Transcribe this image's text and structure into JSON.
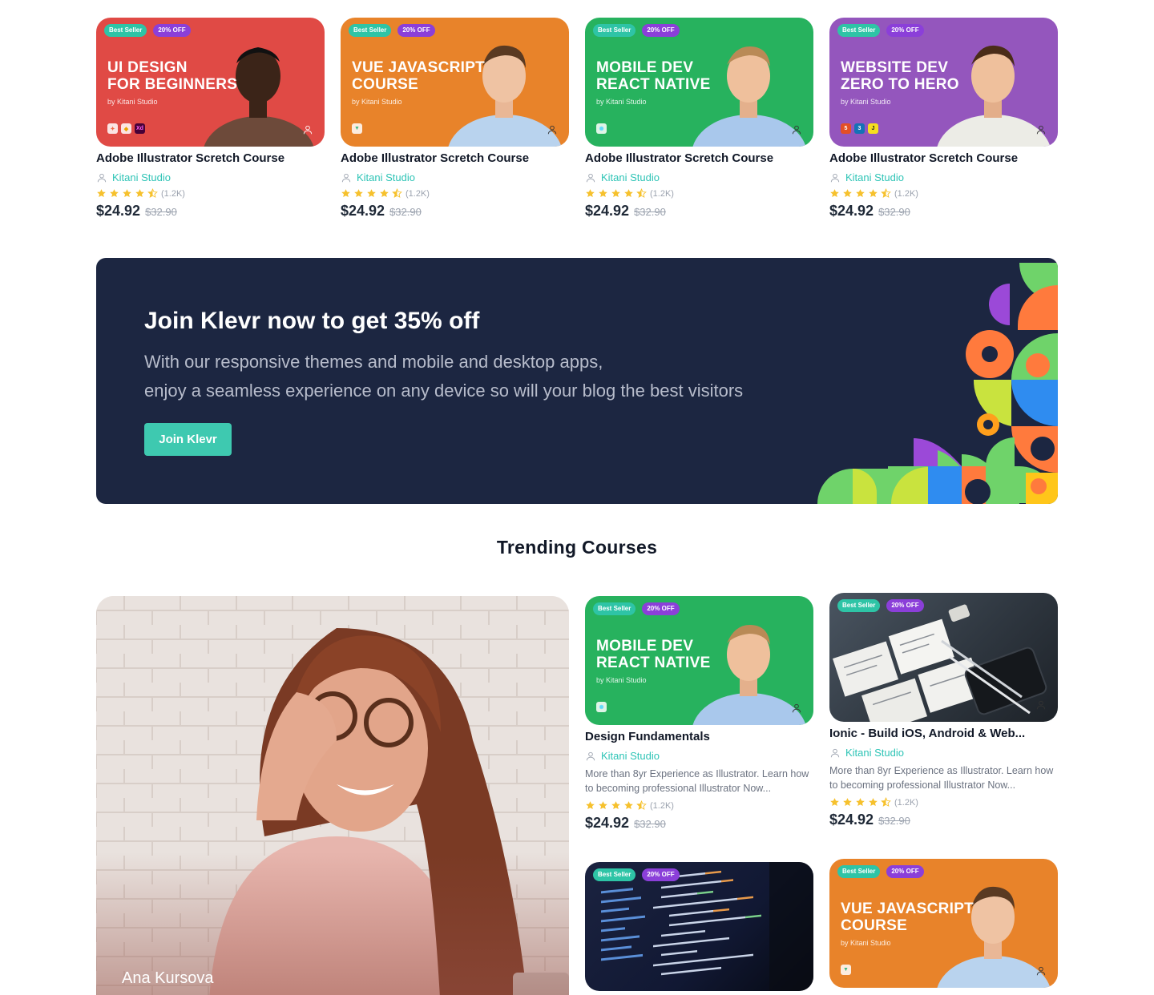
{
  "badges": {
    "seller": "Best Seller",
    "off": "20% OFF"
  },
  "top_cards": [
    {
      "thumb_lines": [
        "UI DESIGN",
        "FOR BEGINNERS"
      ],
      "by": "by Kitani Studio",
      "color": "#e04a45",
      "tools": [
        "figma-icon",
        "sketch-icon",
        "xd-icon"
      ],
      "title": "Adobe Illustrator Scretch Course",
      "author": "Kitani Studio",
      "rating_count": "(1.2K)",
      "rating": 4.5,
      "price": "$24.92",
      "old_price": "$32.90"
    },
    {
      "thumb_lines": [
        "VUE JAVASCRIPT",
        "COURSE"
      ],
      "by": "by Kitani Studio",
      "color": "#e8832a",
      "tools": [
        "vue-icon"
      ],
      "title": "Adobe Illustrator Scretch Course",
      "author": "Kitani Studio",
      "rating_count": "(1.2K)",
      "rating": 4.5,
      "price": "$24.92",
      "old_price": "$32.90"
    },
    {
      "thumb_lines": [
        "MOBILE DEV",
        "REACT NATIVE"
      ],
      "by": "by Kitani Studio",
      "color": "#27b25e",
      "tools": [
        "react-icon"
      ],
      "title": "Adobe Illustrator Scretch Course",
      "author": "Kitani Studio",
      "rating_count": "(1.2K)",
      "rating": 4.5,
      "price": "$24.92",
      "old_price": "$32.90"
    },
    {
      "thumb_lines": [
        "WEBSITE DEV",
        "ZERO TO HERO"
      ],
      "by": "by Kitani Studio",
      "color": "#9456bd",
      "tools": [
        "html5-icon",
        "css3-icon",
        "js-icon"
      ],
      "title": "Adobe Illustrator Scretch Course",
      "author": "Kitani Studio",
      "rating_count": "(1.2K)",
      "rating": 4.5,
      "price": "$24.92",
      "old_price": "$32.90"
    }
  ],
  "banner": {
    "title": "Join Klevr now to get 35% off",
    "text_line1": "With our responsive themes and mobile and desktop apps,",
    "text_line2": "enjoy a seamless experience on any device so will your blog the best visitors",
    "button": "Join Klevr"
  },
  "trending": {
    "title": "Trending Courses",
    "feature_name": "Ana Kursova",
    "cards": [
      {
        "thumb_lines": [
          "MOBILE DEV",
          "REACT NATIVE"
        ],
        "by": "by Kitani Studio",
        "title": "Design Fundamentals",
        "author": "Kitani Studio",
        "desc": "More than 8yr Experience as Illustrator. Learn how to becoming professional Illustrator Now...",
        "rating_count": "(1.2K)",
        "rating": 4.5,
        "price": "$24.92",
        "old_price": "$32.90"
      },
      {
        "title": "Ionic - Build iOS, Android & Web...",
        "author": "Kitani Studio",
        "desc": "More than 8yr Experience as Illustrator. Learn how to becoming professional Illustrator Now...",
        "rating_count": "(1.2K)",
        "rating": 4.5,
        "price": "$24.92",
        "old_price": "$32.90"
      },
      {
        "thumb_lines": [
          "VUE JAVASCRIPT",
          "COURSE"
        ],
        "by": "by Kitani Studio"
      }
    ]
  },
  "colors": {
    "accent": "#2ec4b6",
    "banner_bg": "#1c2641",
    "star": "#f6c12d"
  }
}
